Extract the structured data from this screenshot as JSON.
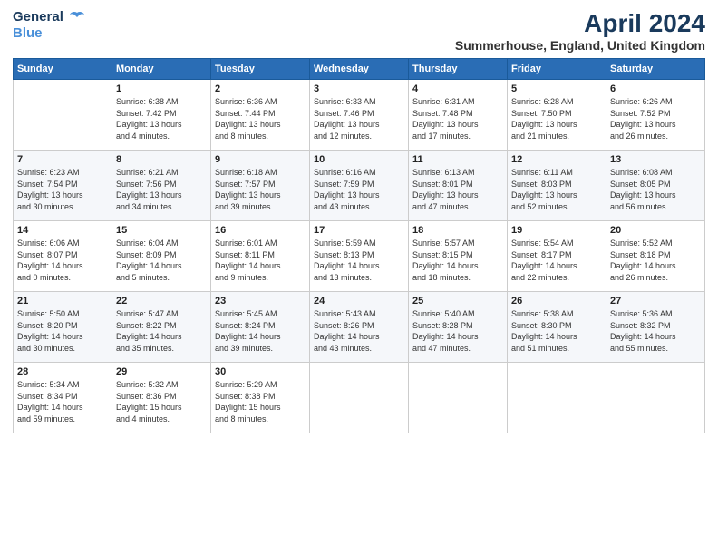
{
  "logo": {
    "line1": "General",
    "line2": "Blue"
  },
  "title": "April 2024",
  "location": "Summerhouse, England, United Kingdom",
  "days_header": [
    "Sunday",
    "Monday",
    "Tuesday",
    "Wednesday",
    "Thursday",
    "Friday",
    "Saturday"
  ],
  "weeks": [
    [
      {
        "day": "",
        "info": ""
      },
      {
        "day": "1",
        "info": "Sunrise: 6:38 AM\nSunset: 7:42 PM\nDaylight: 13 hours\nand 4 minutes."
      },
      {
        "day": "2",
        "info": "Sunrise: 6:36 AM\nSunset: 7:44 PM\nDaylight: 13 hours\nand 8 minutes."
      },
      {
        "day": "3",
        "info": "Sunrise: 6:33 AM\nSunset: 7:46 PM\nDaylight: 13 hours\nand 12 minutes."
      },
      {
        "day": "4",
        "info": "Sunrise: 6:31 AM\nSunset: 7:48 PM\nDaylight: 13 hours\nand 17 minutes."
      },
      {
        "day": "5",
        "info": "Sunrise: 6:28 AM\nSunset: 7:50 PM\nDaylight: 13 hours\nand 21 minutes."
      },
      {
        "day": "6",
        "info": "Sunrise: 6:26 AM\nSunset: 7:52 PM\nDaylight: 13 hours\nand 26 minutes."
      }
    ],
    [
      {
        "day": "7",
        "info": "Sunrise: 6:23 AM\nSunset: 7:54 PM\nDaylight: 13 hours\nand 30 minutes."
      },
      {
        "day": "8",
        "info": "Sunrise: 6:21 AM\nSunset: 7:56 PM\nDaylight: 13 hours\nand 34 minutes."
      },
      {
        "day": "9",
        "info": "Sunrise: 6:18 AM\nSunset: 7:57 PM\nDaylight: 13 hours\nand 39 minutes."
      },
      {
        "day": "10",
        "info": "Sunrise: 6:16 AM\nSunset: 7:59 PM\nDaylight: 13 hours\nand 43 minutes."
      },
      {
        "day": "11",
        "info": "Sunrise: 6:13 AM\nSunset: 8:01 PM\nDaylight: 13 hours\nand 47 minutes."
      },
      {
        "day": "12",
        "info": "Sunrise: 6:11 AM\nSunset: 8:03 PM\nDaylight: 13 hours\nand 52 minutes."
      },
      {
        "day": "13",
        "info": "Sunrise: 6:08 AM\nSunset: 8:05 PM\nDaylight: 13 hours\nand 56 minutes."
      }
    ],
    [
      {
        "day": "14",
        "info": "Sunrise: 6:06 AM\nSunset: 8:07 PM\nDaylight: 14 hours\nand 0 minutes."
      },
      {
        "day": "15",
        "info": "Sunrise: 6:04 AM\nSunset: 8:09 PM\nDaylight: 14 hours\nand 5 minutes."
      },
      {
        "day": "16",
        "info": "Sunrise: 6:01 AM\nSunset: 8:11 PM\nDaylight: 14 hours\nand 9 minutes."
      },
      {
        "day": "17",
        "info": "Sunrise: 5:59 AM\nSunset: 8:13 PM\nDaylight: 14 hours\nand 13 minutes."
      },
      {
        "day": "18",
        "info": "Sunrise: 5:57 AM\nSunset: 8:15 PM\nDaylight: 14 hours\nand 18 minutes."
      },
      {
        "day": "19",
        "info": "Sunrise: 5:54 AM\nSunset: 8:17 PM\nDaylight: 14 hours\nand 22 minutes."
      },
      {
        "day": "20",
        "info": "Sunrise: 5:52 AM\nSunset: 8:18 PM\nDaylight: 14 hours\nand 26 minutes."
      }
    ],
    [
      {
        "day": "21",
        "info": "Sunrise: 5:50 AM\nSunset: 8:20 PM\nDaylight: 14 hours\nand 30 minutes."
      },
      {
        "day": "22",
        "info": "Sunrise: 5:47 AM\nSunset: 8:22 PM\nDaylight: 14 hours\nand 35 minutes."
      },
      {
        "day": "23",
        "info": "Sunrise: 5:45 AM\nSunset: 8:24 PM\nDaylight: 14 hours\nand 39 minutes."
      },
      {
        "day": "24",
        "info": "Sunrise: 5:43 AM\nSunset: 8:26 PM\nDaylight: 14 hours\nand 43 minutes."
      },
      {
        "day": "25",
        "info": "Sunrise: 5:40 AM\nSunset: 8:28 PM\nDaylight: 14 hours\nand 47 minutes."
      },
      {
        "day": "26",
        "info": "Sunrise: 5:38 AM\nSunset: 8:30 PM\nDaylight: 14 hours\nand 51 minutes."
      },
      {
        "day": "27",
        "info": "Sunrise: 5:36 AM\nSunset: 8:32 PM\nDaylight: 14 hours\nand 55 minutes."
      }
    ],
    [
      {
        "day": "28",
        "info": "Sunrise: 5:34 AM\nSunset: 8:34 PM\nDaylight: 14 hours\nand 59 minutes."
      },
      {
        "day": "29",
        "info": "Sunrise: 5:32 AM\nSunset: 8:36 PM\nDaylight: 15 hours\nand 4 minutes."
      },
      {
        "day": "30",
        "info": "Sunrise: 5:29 AM\nSunset: 8:38 PM\nDaylight: 15 hours\nand 8 minutes."
      },
      {
        "day": "",
        "info": ""
      },
      {
        "day": "",
        "info": ""
      },
      {
        "day": "",
        "info": ""
      },
      {
        "day": "",
        "info": ""
      }
    ]
  ]
}
